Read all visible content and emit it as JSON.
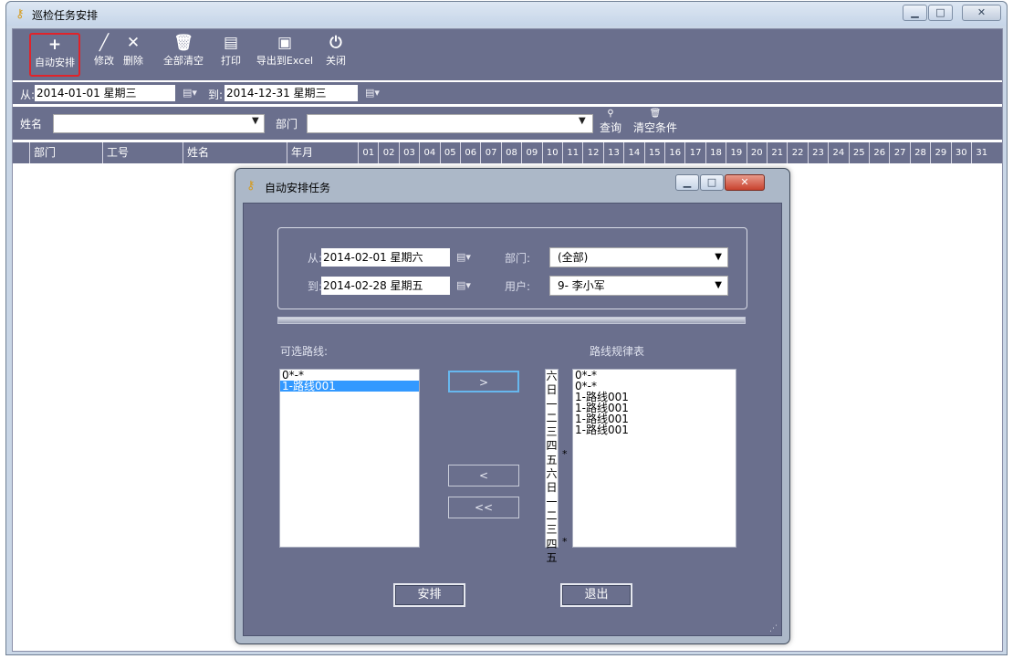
{
  "window": {
    "title": "巡检任务安排"
  },
  "toolbar": [
    {
      "label": "自动安排",
      "icon": "plus-icon"
    },
    {
      "label": "修改",
      "icon": "pencil-icon"
    },
    {
      "label": "删除",
      "icon": "x-icon"
    },
    {
      "label": "全部清空",
      "icon": "trash-icon"
    },
    {
      "label": "打印",
      "icon": "printer-icon"
    },
    {
      "label": "导出到Excel",
      "icon": "excel-icon"
    },
    {
      "label": "关闭",
      "icon": "power-icon"
    }
  ],
  "date_filter": {
    "from_label": "从:",
    "from_value": "2014-01-01 星期三",
    "to_label": "到:",
    "to_value": "2014-12-31 星期三"
  },
  "filter": {
    "name_label": "姓名",
    "dept_label": "部门",
    "query_label": "查询",
    "clear_label": "清空条件"
  },
  "grid": {
    "columns": [
      "部门",
      "工号",
      "姓名",
      "年月"
    ],
    "days": [
      "01",
      "02",
      "03",
      "04",
      "05",
      "06",
      "07",
      "08",
      "09",
      "10",
      "11",
      "12",
      "13",
      "14",
      "15",
      "16",
      "17",
      "18",
      "19",
      "20",
      "21",
      "22",
      "23",
      "24",
      "25",
      "26",
      "27",
      "28",
      "29",
      "30",
      "31"
    ]
  },
  "dialog": {
    "title": "自动安排任务",
    "from_label": "从:",
    "from_value": "2014-02-01 星期六",
    "to_label": "到:",
    "to_value": "2014-02-28 星期五",
    "dept_label": "部门:",
    "dept_value": "(全部)",
    "user_label": "用户:",
    "user_value": "9- 李小军",
    "available_title": "可选路线:",
    "rules_title": "路线规律表",
    "available_routes": [
      "0*-*",
      "1-路线001"
    ],
    "selected_route_index": 1,
    "weekdays": [
      "六",
      "日",
      "一",
      "二",
      "三",
      "四",
      "五",
      "六",
      "日",
      "一",
      "二",
      "三",
      "四",
      "五"
    ],
    "rules": [
      "0*-*",
      "0*-*",
      "1-路线001",
      "1-路线001",
      "1-路线001",
      "1-路线001"
    ],
    "add_label": ">",
    "remove_label": "<",
    "remove_all_label": "<<",
    "arrange_label": "安排",
    "exit_label": "退出"
  }
}
